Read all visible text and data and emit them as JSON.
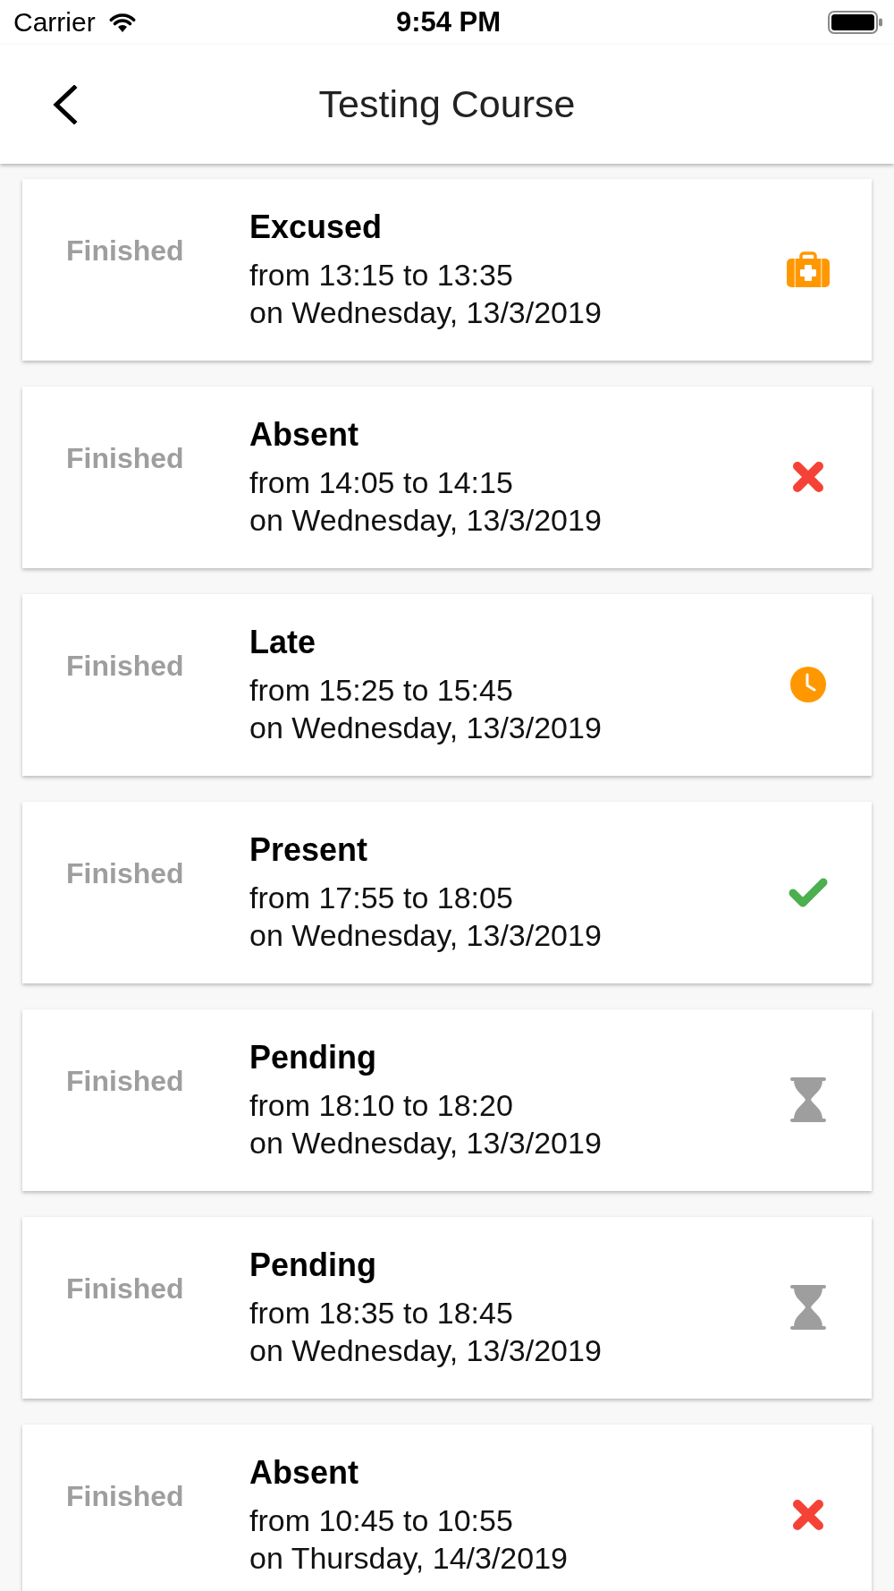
{
  "status_bar": {
    "carrier": "Carrier",
    "time": "9:54 PM"
  },
  "header": {
    "title": "Testing Course"
  },
  "sessions": [
    {
      "status": "Finished",
      "title": "Excused",
      "time": "from 13:15 to 13:35",
      "date": "on Wednesday, 13/3/2019",
      "kind": "excused"
    },
    {
      "status": "Finished",
      "title": "Absent",
      "time": "from 14:05 to 14:15",
      "date": "on Wednesday, 13/3/2019",
      "kind": "absent"
    },
    {
      "status": "Finished",
      "title": "Late",
      "time": "from 15:25 to 15:45",
      "date": "on Wednesday, 13/3/2019",
      "kind": "late"
    },
    {
      "status": "Finished",
      "title": "Present",
      "time": "from 17:55 to 18:05",
      "date": "on Wednesday, 13/3/2019",
      "kind": "present"
    },
    {
      "status": "Finished",
      "title": "Pending",
      "time": "from 18:10 to 18:20",
      "date": "on Wednesday, 13/3/2019",
      "kind": "pending"
    },
    {
      "status": "Finished",
      "title": "Pending",
      "time": "from 18:35 to 18:45",
      "date": "on Wednesday, 13/3/2019",
      "kind": "pending"
    },
    {
      "status": "Finished",
      "title": "Absent",
      "time": "from 10:45 to 10:55",
      "date": "on Thursday, 14/3/2019",
      "kind": "absent"
    }
  ]
}
